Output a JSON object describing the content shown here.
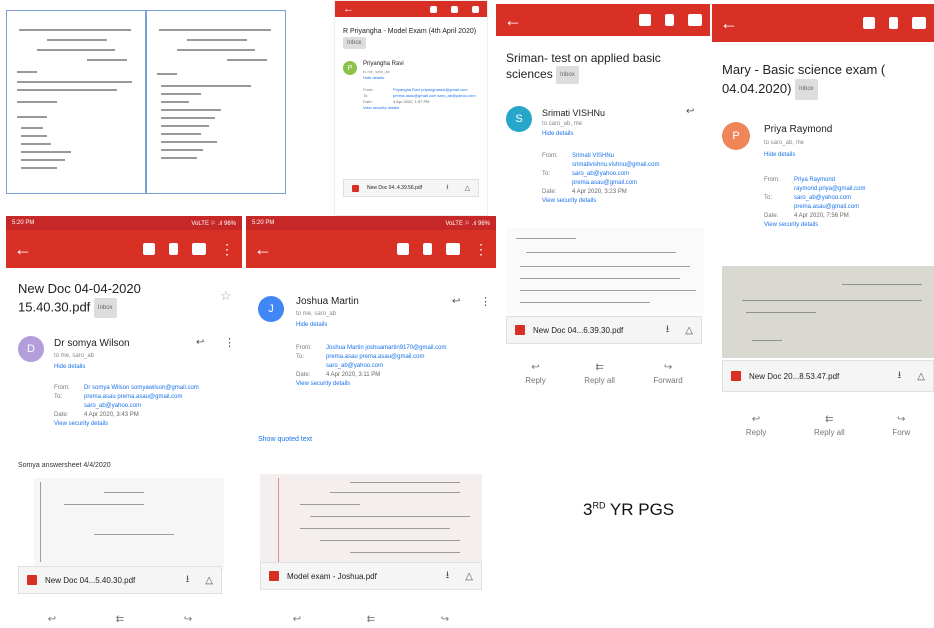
{
  "caption": {
    "prefix": "3",
    "sup": "RD",
    "suffix": " YR PGS"
  },
  "status_time": "5:20 PM",
  "status_info": "VoLTE ⚐ .ıl 96%",
  "panel_b": {
    "subject": "R Priyangha - Model Exam (4th April 2020)",
    "tag": "Inbox",
    "sender": "Priyangha Ravi",
    "to": "to me, saro_ab",
    "hide": "Hide details",
    "from_k": "From:",
    "from_v": "Priyangha Ravi priyangharavi@gmail.com",
    "to_k": "To:",
    "to_v": "prema.asau@gmail.com saro_ab@yahoo.com",
    "date_k": "Date:",
    "date_v": "4 Apr 2020, 1:57 PM",
    "security": "View security details",
    "attachment": "New Doc 04..4.39.56.pdf"
  },
  "panel_c": {
    "subject": "Sriman- test on applied basic sciences",
    "tag": "Inbox",
    "sender": "Srimati VISHNu",
    "to": "to saro_ab, me",
    "hide": "Hide details",
    "from_k": "From:",
    "from_v": "Srimati VISHNu srimativishnu.vishnu@gmail.com",
    "to_k": "To:",
    "to_v": "saro_ab@yahoo.com prema.asau@gmail.com",
    "date_k": "Date:",
    "date_v": "4 Apr 2020, 3:23 PM",
    "security": "View security details",
    "attachment": "New Doc 04...6.39.30.pdf",
    "reply": "Reply",
    "reply_all": "Reply all",
    "forward": "Forward"
  },
  "panel_d": {
    "subject": "Mary - Basic science exam ( 04.04.2020)",
    "tag": "Inbox",
    "sender": "Priya Raymond",
    "avatar": "P",
    "to": "to saro_ab, me",
    "hide": "Hide details",
    "from_k": "From:",
    "from_v": "Priya Raymond raymond.priya@gmail.com",
    "to_k": "To:",
    "to_v": "saro_ab@yahoo.com prema.asau@gmail.com",
    "date_k": "Date:",
    "date_v": "4 Apr 2020, 7:56 PM",
    "security": "View security details",
    "attachment": "New Doc 20...8.53.47.pdf",
    "reply": "Reply",
    "reply_all": "Reply all",
    "forward": "Forw"
  },
  "panel_e": {
    "subject": "New Doc 04-04-2020 15.40.30.pdf",
    "tag": "Inbox",
    "sender": "Dr somya Wilson",
    "avatar": "D",
    "to": "to me, saro_ab",
    "hide": "Hide details",
    "from_k": "From:",
    "from_v": "Dr somya Wilson somyawilson@gmail.com",
    "to_k": "To:",
    "to_v": "prema.asau prema.asau@gmail.com saro_ab@yahoo.com",
    "date_k": "Date:",
    "date_v": "4 Apr 2020, 3:43 PM",
    "security": "View security details",
    "body": "Somya answersheet 4/4/2020",
    "attachment": "New Doc 04...5.40.30.pdf"
  },
  "panel_f": {
    "sender": "Joshua Martin",
    "avatar": "J",
    "to": "to me, saro_ab",
    "hide": "Hide details",
    "from_k": "From:",
    "from_v": "Joshua Martin joshuamartin9170@gmail.com",
    "to_k": "To:",
    "to_v": "prema.asau prema.asau@gmail.com saro_ab@yahoo.com",
    "date_k": "Date:",
    "date_v": "4 Apr 2020, 3:11 PM",
    "security": "View security details",
    "quoted": "Show quoted text",
    "attachment": "Model exam - Joshua.pdf"
  },
  "colors": {
    "appbar": "#d93025",
    "link": "#1a73e8",
    "avatar_b": "#8bc34a",
    "avatar_c": "#26a6c9",
    "avatar_d": "#f0855a",
    "avatar_e": "#b39ddb",
    "avatar_f": "#4285f4"
  }
}
